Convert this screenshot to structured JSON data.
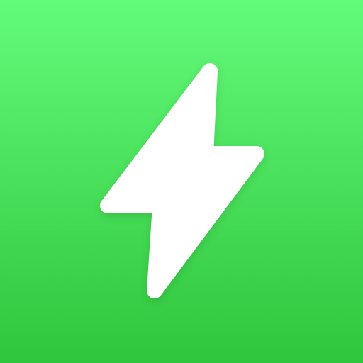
{
  "icon": {
    "name": "lightning-bolt-icon",
    "symbol_color": "#FFFFFF",
    "background": {
      "gradient_top": "#63FB7A",
      "gradient_bottom": "#2FC53C"
    }
  }
}
